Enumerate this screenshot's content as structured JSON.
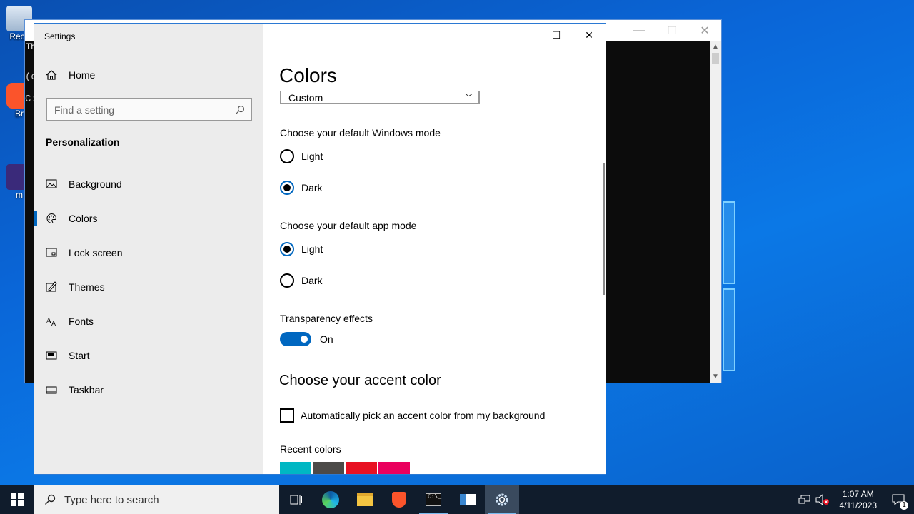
{
  "desktop": {
    "icons": [
      {
        "label": "Recy"
      },
      {
        "label": "Br"
      },
      {
        "label": "m"
      }
    ]
  },
  "console": {
    "lines": [
      "(c",
      "C:"
    ],
    "overlay_text": "Th"
  },
  "settings": {
    "app_title": "Settings",
    "nav": {
      "home_label": "Home",
      "search_placeholder": "Find a setting",
      "section_title": "Personalization",
      "items": [
        {
          "label": "Background",
          "icon": "image-icon"
        },
        {
          "label": "Colors",
          "icon": "palette-icon",
          "active": true
        },
        {
          "label": "Lock screen",
          "icon": "lock-screen-icon"
        },
        {
          "label": "Themes",
          "icon": "themes-icon"
        },
        {
          "label": "Fonts",
          "icon": "fonts-icon"
        },
        {
          "label": "Start",
          "icon": "start-icon"
        },
        {
          "label": "Taskbar",
          "icon": "taskbar-icon"
        }
      ]
    },
    "content": {
      "title": "Colors",
      "color_dropdown_value": "Custom",
      "windows_mode": {
        "label": "Choose your default Windows mode",
        "options": [
          "Light",
          "Dark"
        ],
        "selected": "Dark"
      },
      "app_mode": {
        "label": "Choose your default app mode",
        "options": [
          "Light",
          "Dark"
        ],
        "selected": "Light"
      },
      "transparency": {
        "label": "Transparency effects",
        "state": "On"
      },
      "accent_heading": "Choose your accent color",
      "auto_accent_label": "Automatically pick an accent color from my background",
      "recent_colors_label": "Recent colors",
      "recent_colors": [
        "#00b7c3",
        "#4c4a48",
        "#e81123",
        "#ea005e"
      ]
    }
  },
  "taskbar": {
    "search_placeholder": "Type here to search",
    "time": "1:07 AM",
    "date": "4/11/2023",
    "notification_count": "1",
    "apps": [
      "task-view-icon",
      "edge-icon",
      "file-explorer-icon",
      "brave-icon",
      "terminal-icon",
      "news-icon",
      "settings-icon"
    ]
  },
  "colors": {
    "accent": "#0067c0",
    "taskbar": "#101c2c",
    "nav_bg": "#ececec"
  }
}
